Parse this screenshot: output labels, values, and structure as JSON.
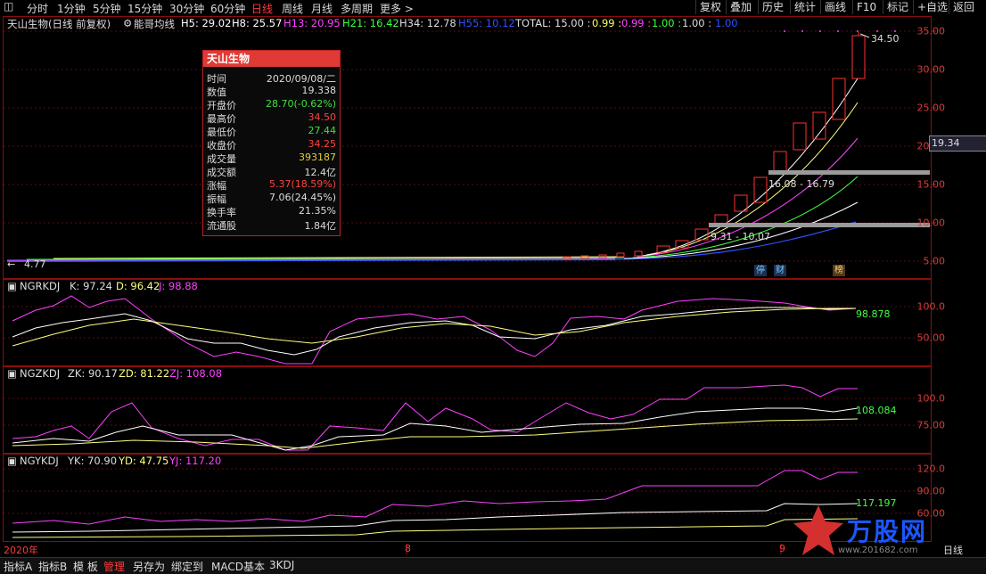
{
  "toolbar": {
    "periods": [
      "分时",
      "1分钟",
      "5分钟",
      "15分钟",
      "30分钟",
      "60分钟",
      "日线",
      "周线",
      "月线",
      "多周期",
      "更多 >"
    ],
    "active_period": "日线",
    "right_items": [
      "复权",
      "叠加",
      "历史",
      "统计",
      "画线",
      "F10",
      "+自选",
      "返回"
    ]
  },
  "main": {
    "stock_title": "天山生物(日线 前复权)",
    "indicator_name": "能哥均线",
    "ma": [
      {
        "label": "H5: 29.02",
        "color": "#ffffff"
      },
      {
        "label": "H8: 25.57",
        "color": "#ffffff"
      },
      {
        "label": "H13: 20.95",
        "color": "#ff40ff"
      },
      {
        "label": "H21: 16.42",
        "color": "#40ff40"
      },
      {
        "label": "H34: 12.78",
        "color": "#ffffff"
      },
      {
        "label": "H55: 10.12",
        "color": "#3050ff"
      },
      {
        "label": "TOTAL: 15.00 :",
        "color": "#ffffff"
      },
      {
        "label": "0.99 :",
        "color": "#ffff60"
      },
      {
        "label": "0.99 :",
        "color": "#ff40ff"
      },
      {
        "label": "1.00 :",
        "color": "#40ff40"
      },
      {
        "label": "1.00 :",
        "color": "#ffffff"
      },
      {
        "label": "1.00",
        "color": "#3050ff"
      }
    ],
    "y_axis": [
      "35.00",
      "30.00",
      "25.00",
      "20.00",
      "15.00",
      "10.00",
      "5.00"
    ],
    "current_price": "19.34",
    "high_label": "34.50",
    "low_label": "4.77",
    "zone1": "16.08 - 16.79",
    "zone2": "9.31 - 10.07",
    "badges": [
      "停",
      "财",
      "榜"
    ]
  },
  "tooltip": {
    "title": "天山生物",
    "rows": [
      {
        "k": "时间",
        "v": "2020/09/08/二",
        "c": "#dddddd"
      },
      {
        "k": "数值",
        "v": "19.338",
        "c": "#dddddd"
      },
      {
        "k": "开盘价",
        "v": "28.70(-0.62%)",
        "c": "#40e040"
      },
      {
        "k": "最高价",
        "v": "34.50",
        "c": "#ff4040"
      },
      {
        "k": "最低价",
        "v": "27.44",
        "c": "#40e040"
      },
      {
        "k": "收盘价",
        "v": "34.25",
        "c": "#ff4040"
      },
      {
        "k": "成交量",
        "v": "393187",
        "c": "#e0d040"
      },
      {
        "k": "成交额",
        "v": "12.4亿",
        "c": "#dddddd"
      },
      {
        "k": "涨幅",
        "v": "5.37(18.59%)",
        "c": "#ff4040"
      },
      {
        "k": "振幅",
        "v": "7.06(24.45%)",
        "c": "#dddddd"
      },
      {
        "k": "换手率",
        "v": "21.35%",
        "c": "#dddddd"
      },
      {
        "k": "流通股",
        "v": "1.84亿",
        "c": "#dddddd"
      }
    ]
  },
  "panels": [
    {
      "name": "NGRKDJ",
      "k": "K: 97.24",
      "d": "D: 96.42",
      "j": "J: 98.88",
      "y": [
        "100.0",
        "50.00"
      ],
      "last": "98.878"
    },
    {
      "name": "NGZKDJ",
      "k": "ZK: 90.17",
      "d": "ZD: 81.22",
      "j": "ZJ: 108.08",
      "y": [
        "100.0",
        "75.00"
      ],
      "last": "108.084"
    },
    {
      "name": "NGYKDJ",
      "k": "YK: 70.90",
      "d": "YD: 47.75",
      "j": "YJ: 117.20",
      "y": [
        "120.0",
        "90.00",
        "60.00"
      ],
      "last": "117.197"
    }
  ],
  "time_axis": {
    "year": "2020年",
    "m8": "8",
    "m9": "9",
    "period": "日线"
  },
  "bottom": [
    "指标A",
    "指标B",
    "模 板",
    "管理",
    "另存为",
    "绑定到",
    "MACD基本",
    "3KDJ"
  ],
  "bottom_active": "管理",
  "watermark": {
    "brand": "万股网",
    "url": "www.201682.com"
  }
}
